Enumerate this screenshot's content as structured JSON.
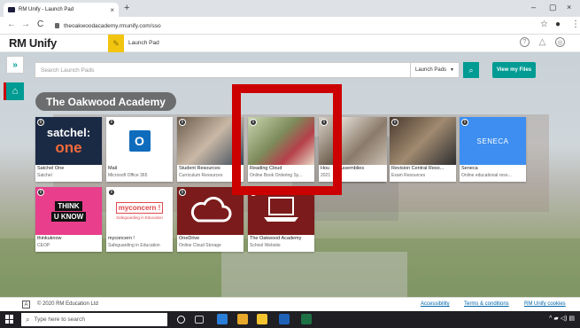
{
  "browser": {
    "tab_title": "RM Unify - Launch Pad",
    "tab_close": "×",
    "new_tab": "+",
    "url": "theoakwoodacademy.rmunify.com/sso",
    "back": "←",
    "forward": "→",
    "reload": "C",
    "minimize": "–",
    "maximize": "▢",
    "close": "×",
    "star": "☆",
    "profile": "●",
    "menu": "⋮"
  },
  "header": {
    "logo": "RM Unify",
    "launchpad_label": "Launch Pad",
    "help": "?",
    "bell": "△",
    "user": "◎"
  },
  "sidebar": {
    "expand": "»",
    "home": "⌂"
  },
  "search": {
    "placeholder": "Search Launch Pads",
    "scope": "Launch Pads",
    "scope_caret": "▼",
    "button": "⌕",
    "view_files": "View my Files"
  },
  "school_name": "The Oakwood Academy",
  "tiles_row1": [
    {
      "title": "Satchel One",
      "subtitle": "Satchel",
      "thumb_line1": "satchel:",
      "thumb_line2": "one"
    },
    {
      "title": "Mail",
      "subtitle": "Microsoft Office 365",
      "thumb_line1": "O",
      "thumb_line2": ""
    },
    {
      "title": "Student Resources",
      "subtitle": "Curriculum Resources",
      "thumb_line1": "",
      "thumb_line2": ""
    },
    {
      "title": "Reading Cloud",
      "subtitle": "Online Book Ordering Sy...",
      "thumb_line1": "",
      "thumb_line2": ""
    },
    {
      "title": "Hou",
      "subtitle": "2021",
      "thumb_line1": "",
      "thumb_line2": ""
    },
    {
      "title": "Assemblies",
      "subtitle": "",
      "thumb_line1": "",
      "thumb_line2": ""
    },
    {
      "title": "Revision Central Reso...",
      "subtitle": "Exam Resources",
      "thumb_line1": "",
      "thumb_line2": ""
    },
    {
      "title": "Seneca",
      "subtitle": "Online educational reso...",
      "thumb_line1": "SENECA",
      "thumb_line2": ""
    }
  ],
  "tiles_row2": [
    {
      "title": "thinkuknow",
      "subtitle": "CEOP",
      "thumb_line1": "THINK",
      "thumb_line2": "U KNOW"
    },
    {
      "title": "myconcern !",
      "subtitle": "Safeguarding in Education",
      "thumb_line1": "myconcern !",
      "thumb_line2": "Safeguarding in Education"
    },
    {
      "title": "OneDrive",
      "subtitle": "Online Cloud Storage",
      "thumb_line1": "",
      "thumb_line2": ""
    },
    {
      "title": "The Oakwood Academy",
      "subtitle": "School Website",
      "thumb_line1": "",
      "thumb_line2": ""
    }
  ],
  "info_badge": "i",
  "footer": {
    "acc_icon": "A",
    "copyright": "© 2020 RM Education Ltd",
    "accessibility": "Accessibility",
    "terms": "Terms & conditions",
    "cookies": "RM Unify cookies"
  },
  "taskbar": {
    "search_placeholder": "Type here to search",
    "search_icon": "⌕",
    "tray": "^ ▰ ◁) ▤"
  }
}
